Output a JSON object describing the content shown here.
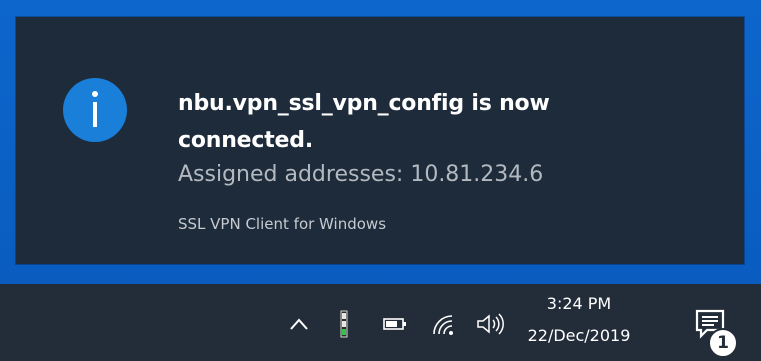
{
  "notification": {
    "icon": "info-icon",
    "title": "nbu.vpn_ssl_vpn_config is now connected.",
    "body": "Assigned addresses: 10.81.234.6",
    "attribution": "SSL VPN Client for Windows",
    "colors": {
      "background": "#1e2b3a",
      "icon": "#1a7fd8"
    }
  },
  "taskbar": {
    "tray_icons": [
      "chevron-up-icon",
      "vpn-client-icon",
      "battery-icon",
      "wifi-icon",
      "volume-icon"
    ],
    "time": "3:24 PM",
    "date": "22/Dec/2019",
    "action_center": {
      "icon": "action-center-icon",
      "badge_count": "1"
    },
    "colors": {
      "background": "#232d3a"
    }
  },
  "desktop": {
    "color": "#0b62c4"
  }
}
